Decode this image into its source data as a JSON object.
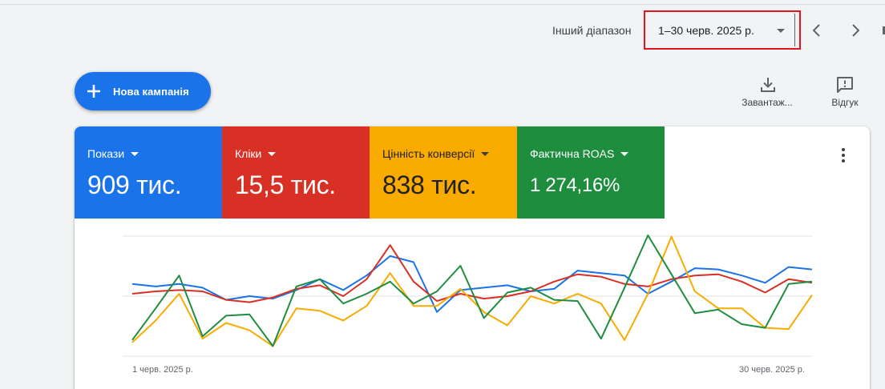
{
  "header": {
    "range_label": "Інший діапазон",
    "date_range": "1–30 черв. 2025 р.",
    "prev_icon": "chevron-left-icon",
    "next_icon": "chevron-right-icon"
  },
  "actions": {
    "new_campaign": "Нова кампанія",
    "download": "Завантаж...",
    "feedback": "Відгук"
  },
  "metrics": [
    {
      "label": "Покази",
      "value": "909 тис.",
      "color": "#1a73e8"
    },
    {
      "label": "Кліки",
      "value": "15,5 тис.",
      "color": "#d93025"
    },
    {
      "label": "Цінність конверсії",
      "value": "838 тис.",
      "color": "#f9ab00"
    },
    {
      "label": "Фактична ROAS",
      "value": "1 274,16%",
      "color": "#1e8e3e"
    }
  ],
  "chart_data": {
    "type": "line",
    "x": [
      "1 черв. 2025 р.",
      "2",
      "3",
      "4",
      "5",
      "6",
      "7",
      "8",
      "9",
      "10",
      "11",
      "12",
      "13",
      "14",
      "15",
      "16",
      "17",
      "18",
      "19",
      "20",
      "21",
      "22",
      "23",
      "24",
      "25",
      "26",
      "27",
      "28",
      "29",
      "30 черв. 2025 р."
    ],
    "x_tick_labels": [
      "1 черв. 2025 р.",
      "30 черв. 2025 р."
    ],
    "y_normalized": true,
    "ylim": [
      0,
      1
    ],
    "gridlines": 3,
    "series": [
      {
        "color": "#1a73e8",
        "values": [
          0.58,
          0.56,
          0.58,
          0.55,
          0.45,
          0.48,
          0.46,
          0.53,
          0.62,
          0.53,
          0.65,
          0.81,
          0.76,
          0.35,
          0.53,
          0.55,
          0.57,
          0.52,
          0.54,
          0.69,
          0.67,
          0.65,
          0.5,
          0.6,
          0.71,
          0.7,
          0.65,
          0.59,
          0.72,
          0.7
        ]
      },
      {
        "color": "#d93025",
        "values": [
          0.5,
          0.52,
          0.53,
          0.52,
          0.45,
          0.43,
          0.47,
          0.54,
          0.57,
          0.48,
          0.62,
          0.9,
          0.6,
          0.44,
          0.5,
          0.46,
          0.48,
          0.52,
          0.6,
          0.66,
          0.64,
          0.58,
          0.56,
          0.62,
          0.65,
          0.66,
          0.6,
          0.51,
          0.62,
          0.59
        ]
      },
      {
        "color": "#f9ab00",
        "values": [
          0.1,
          0.28,
          0.5,
          0.13,
          0.26,
          0.2,
          0.07,
          0.38,
          0.36,
          0.28,
          0.4,
          0.67,
          0.4,
          0.4,
          0.54,
          0.35,
          0.24,
          0.48,
          0.42,
          0.5,
          0.42,
          0.12,
          0.5,
          0.97,
          0.52,
          0.38,
          0.38,
          0.22,
          0.21,
          0.49
        ]
      },
      {
        "color": "#1e8e3e",
        "values": [
          0.12,
          0.38,
          0.65,
          0.15,
          0.32,
          0.33,
          0.07,
          0.56,
          0.62,
          0.42,
          0.5,
          0.6,
          0.42,
          0.52,
          0.73,
          0.3,
          0.51,
          0.55,
          0.45,
          0.44,
          0.13,
          0.55,
          0.98,
          0.66,
          0.34,
          0.37,
          0.25,
          0.22,
          0.58,
          0.6
        ]
      }
    ]
  }
}
